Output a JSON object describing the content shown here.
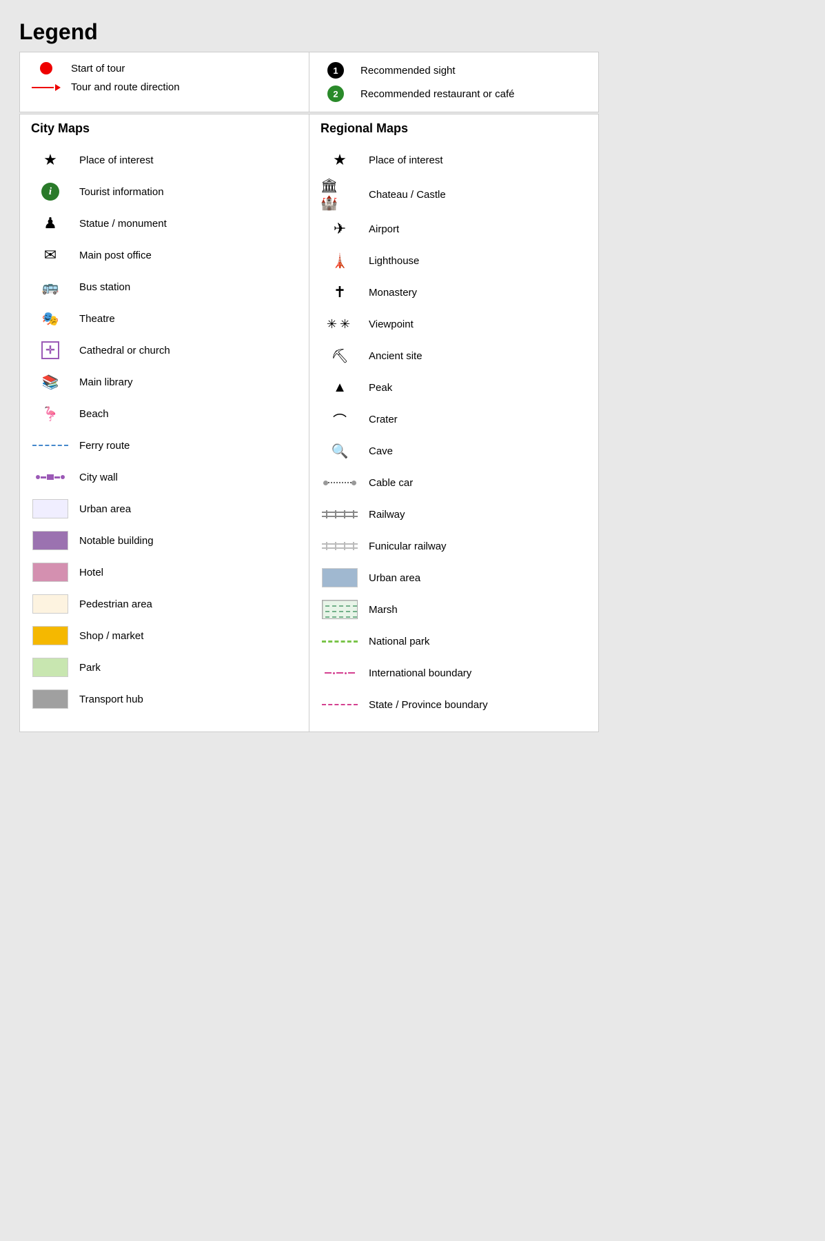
{
  "page": {
    "title": "Legend",
    "top_section": {
      "left_items": [
        {
          "id": "start-tour",
          "icon": "red-dot",
          "label": "Start of tour"
        },
        {
          "id": "route-direction",
          "icon": "red-arrow",
          "label": "Tour and route direction"
        }
      ],
      "right_items": [
        {
          "id": "recommended-sight",
          "icon": "num-1-black",
          "label": "Recommended sight"
        },
        {
          "id": "recommended-restaurant",
          "icon": "num-2-green",
          "label": "Recommended restaurant or café"
        }
      ]
    },
    "city_maps": {
      "heading": "City Maps",
      "items": [
        {
          "id": "place-of-interest-city",
          "icon": "star",
          "label": "Place of interest"
        },
        {
          "id": "tourist-info",
          "icon": "info-green",
          "label": "Tourist information"
        },
        {
          "id": "statue-monument",
          "icon": "pawn",
          "label": "Statue / monument"
        },
        {
          "id": "main-post-office",
          "icon": "envelope",
          "label": "Main post office"
        },
        {
          "id": "bus-station",
          "icon": "bus",
          "label": "Bus station"
        },
        {
          "id": "theatre",
          "icon": "masks",
          "label": "Theatre"
        },
        {
          "id": "cathedral-church",
          "icon": "church-cross",
          "label": "Cathedral or church"
        },
        {
          "id": "main-library",
          "icon": "library",
          "label": "Main library"
        },
        {
          "id": "beach",
          "icon": "beach-bird",
          "label": "Beach"
        },
        {
          "id": "ferry-route",
          "icon": "ferry-dashed",
          "label": "Ferry route"
        },
        {
          "id": "city-wall",
          "icon": "city-wall",
          "label": "City wall"
        },
        {
          "id": "urban-area-city",
          "icon": "swatch-urban",
          "label": "Urban area"
        },
        {
          "id": "notable-building",
          "icon": "swatch-notable",
          "label": "Notable building"
        },
        {
          "id": "hotel",
          "icon": "swatch-hotel",
          "label": "Hotel"
        },
        {
          "id": "pedestrian-area",
          "icon": "swatch-pedestrian",
          "label": "Pedestrian area"
        },
        {
          "id": "shop-market",
          "icon": "swatch-shop",
          "label": "Shop / market"
        },
        {
          "id": "park",
          "icon": "swatch-park",
          "label": "Park"
        },
        {
          "id": "transport-hub",
          "icon": "swatch-transport",
          "label": "Transport hub"
        }
      ]
    },
    "regional_maps": {
      "heading": "Regional Maps",
      "items": [
        {
          "id": "place-of-interest-regional",
          "icon": "star",
          "label": "Place of interest"
        },
        {
          "id": "chateau-castle",
          "icon": "castle",
          "label": "Chateau / Castle"
        },
        {
          "id": "airport",
          "icon": "airplane",
          "label": "Airport"
        },
        {
          "id": "lighthouse",
          "icon": "lighthouse",
          "label": "Lighthouse"
        },
        {
          "id": "monastery",
          "icon": "cross",
          "label": "Monastery"
        },
        {
          "id": "viewpoint",
          "icon": "viewpoint",
          "label": "Viewpoint"
        },
        {
          "id": "ancient-site",
          "icon": "ancient",
          "label": "Ancient site"
        },
        {
          "id": "peak",
          "icon": "peak",
          "label": "Peak"
        },
        {
          "id": "crater",
          "icon": "crater",
          "label": "Crater"
        },
        {
          "id": "cave",
          "icon": "cave",
          "label": "Cave"
        },
        {
          "id": "cable-car",
          "icon": "cable-car",
          "label": "Cable car"
        },
        {
          "id": "railway",
          "icon": "railway",
          "label": "Railway"
        },
        {
          "id": "funicular-railway",
          "icon": "funicular",
          "label": "Funicular railway"
        },
        {
          "id": "urban-area-regional",
          "icon": "swatch-regional-urban",
          "label": "Urban area"
        },
        {
          "id": "marsh",
          "icon": "marsh",
          "label": "Marsh"
        },
        {
          "id": "national-park",
          "icon": "natpark",
          "label": "National park"
        },
        {
          "id": "international-boundary",
          "icon": "intl-boundary",
          "label": "International boundary"
        },
        {
          "id": "state-province-boundary",
          "icon": "state-boundary",
          "label": "State / Province boundary"
        }
      ]
    }
  }
}
